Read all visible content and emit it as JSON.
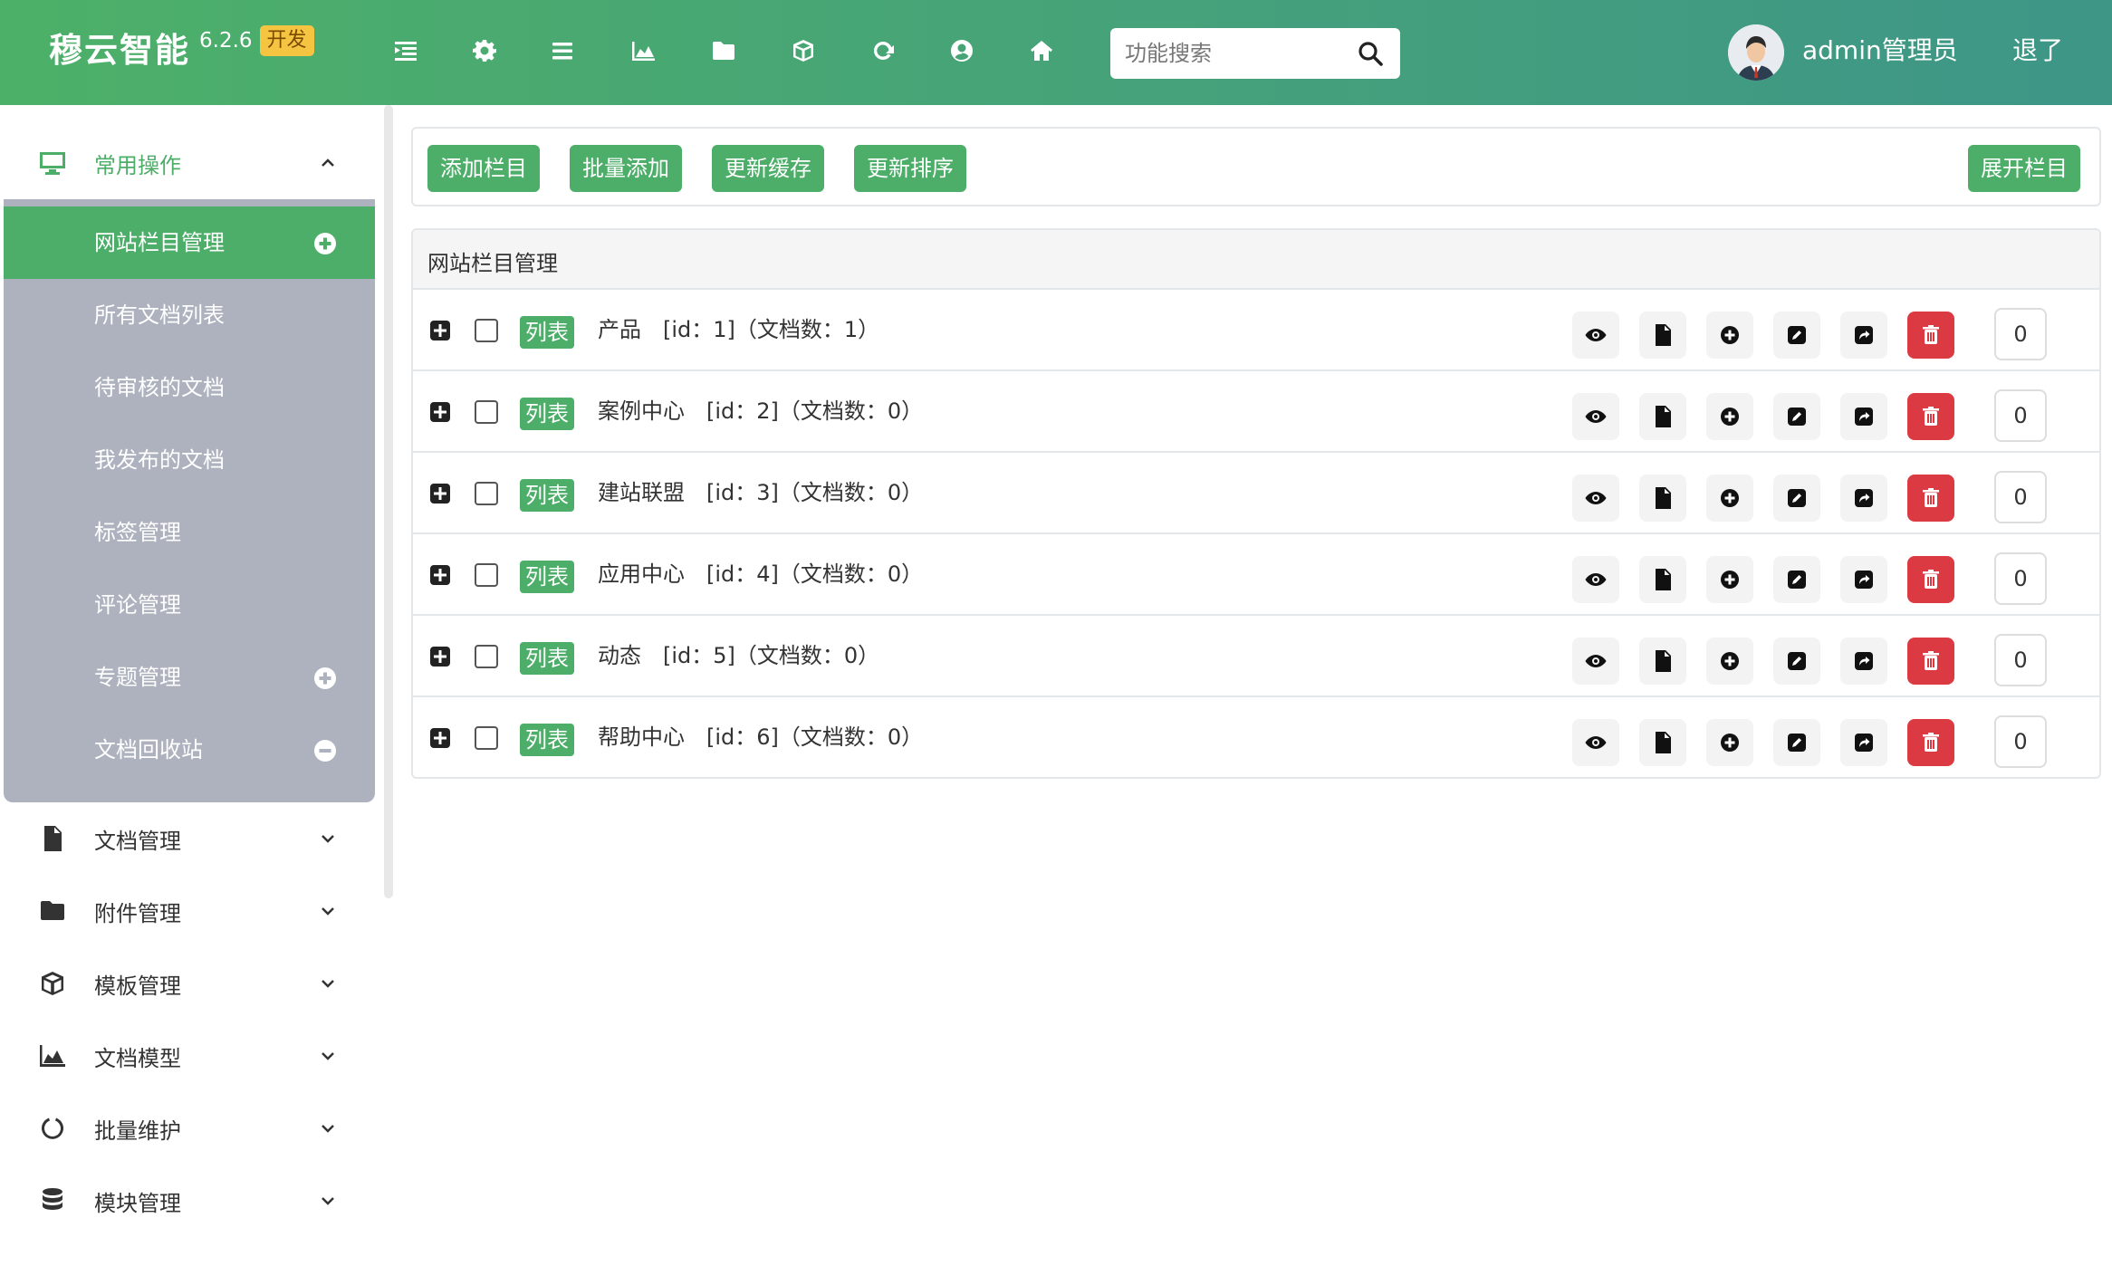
{
  "header": {
    "brand_name": "穆云智能",
    "version": "6.2.6",
    "badge": "开发",
    "search_placeholder": "功能搜索",
    "admin_name": "admin管理员",
    "logout": "退了",
    "icons": [
      "menu-indent-icon",
      "gear-icon",
      "list-icon",
      "area-chart-icon",
      "folder-icon",
      "cube-icon",
      "refresh-icon",
      "user-circle-icon",
      "home-icon"
    ]
  },
  "sidebar": {
    "group_title": "常用操作",
    "sub_items": [
      {
        "label": "网站栏目管理",
        "icon": "plus-circle-icon"
      },
      {
        "label": "所有文档列表"
      },
      {
        "label": "待审核的文档"
      },
      {
        "label": "我发布的文档"
      },
      {
        "label": "标签管理"
      },
      {
        "label": "评论管理"
      },
      {
        "label": "专题管理",
        "icon": "plus-circle-icon"
      },
      {
        "label": "文档回收站",
        "icon": "minus-circle-icon"
      }
    ],
    "menus": [
      {
        "label": "文档管理",
        "icon": "file-icon"
      },
      {
        "label": "附件管理",
        "icon": "folder-icon"
      },
      {
        "label": "模板管理",
        "icon": "cube-icon"
      },
      {
        "label": "文档模型",
        "icon": "area-chart-icon"
      },
      {
        "label": "批量维护",
        "icon": "circle-notch-icon"
      },
      {
        "label": "模块管理",
        "icon": "database-icon"
      }
    ]
  },
  "toolbar": {
    "add_column": "添加栏目",
    "batch_add": "批量添加",
    "update_cache": "更新缓存",
    "update_sort": "更新排序",
    "expand_columns": "展开栏目"
  },
  "panel": {
    "title": "网站栏目管理",
    "tag_label": "列表",
    "rows": [
      {
        "name": "产品",
        "meta": "[id：1]（文档数：1）",
        "sort": "0"
      },
      {
        "name": "案例中心",
        "meta": "[id：2]（文档数：0）",
        "sort": "0"
      },
      {
        "name": "建站联盟",
        "meta": "[id：3]（文档数：0）",
        "sort": "0"
      },
      {
        "name": "应用中心",
        "meta": "[id：4]（文档数：0）",
        "sort": "0"
      },
      {
        "name": "动态",
        "meta": "[id：5]（文档数：0）",
        "sort": "0"
      },
      {
        "name": "帮助中心",
        "meta": "[id：6]（文档数：0）",
        "sort": "0"
      }
    ]
  },
  "colors": {
    "accent": "#4cae68",
    "header_start": "#4db068",
    "header_end": "#3e9687",
    "submenu_bg": "#adb2be",
    "danger": "#dc3a43",
    "badge": "#f5c542"
  }
}
